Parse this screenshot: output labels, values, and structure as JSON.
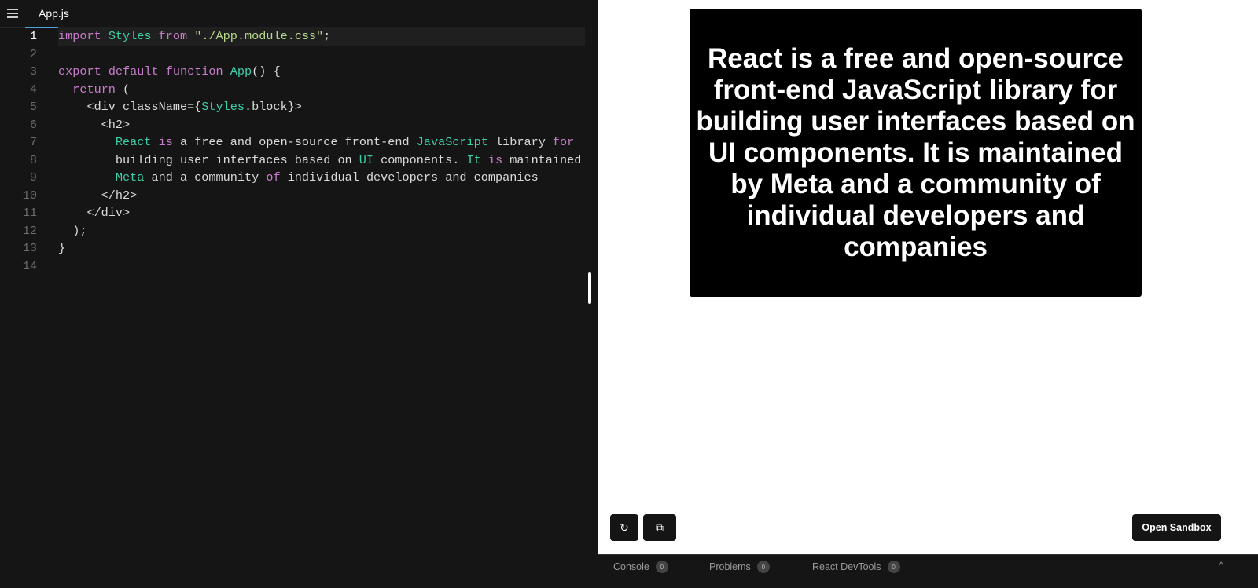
{
  "editor": {
    "tab": "App.js",
    "active_line": 1,
    "lines": [
      [
        [
          "kw",
          "import"
        ],
        [
          "p",
          " "
        ],
        [
          "id",
          "Styles"
        ],
        [
          "p",
          " "
        ],
        [
          "kw",
          "from"
        ],
        [
          "p",
          " "
        ],
        [
          "str",
          "\"./App.module.css\""
        ],
        [
          "p",
          ";"
        ]
      ],
      [],
      [
        [
          "kw",
          "export"
        ],
        [
          "p",
          " "
        ],
        [
          "kw",
          "default"
        ],
        [
          "p",
          " "
        ],
        [
          "kw",
          "function"
        ],
        [
          "p",
          " "
        ],
        [
          "id",
          "App"
        ],
        [
          "p",
          "() {"
        ]
      ],
      [
        [
          "p",
          "  "
        ],
        [
          "kw",
          "return"
        ],
        [
          "p",
          " ("
        ]
      ],
      [
        [
          "p",
          "    <div className={"
        ],
        [
          "id",
          "Styles"
        ],
        [
          "p",
          ".block}>"
        ]
      ],
      [
        [
          "p",
          "      <h2>"
        ]
      ],
      [
        [
          "p",
          "        "
        ],
        [
          "id",
          "React"
        ],
        [
          "p",
          " "
        ],
        [
          "kw",
          "is"
        ],
        [
          "p",
          " a free and open-source front-end "
        ],
        [
          "id",
          "JavaScript"
        ],
        [
          "p",
          " library "
        ],
        [
          "kw",
          "for"
        ]
      ],
      [
        [
          "p",
          "        building user interfaces based on "
        ],
        [
          "id",
          "UI"
        ],
        [
          "p",
          " components. "
        ],
        [
          "id",
          "It"
        ],
        [
          "p",
          " "
        ],
        [
          "kw",
          "is"
        ],
        [
          "p",
          " maintained by"
        ]
      ],
      [
        [
          "p",
          "        "
        ],
        [
          "id",
          "Meta"
        ],
        [
          "p",
          " and a community "
        ],
        [
          "kw",
          "of"
        ],
        [
          "p",
          " individual developers and companies"
        ]
      ],
      [
        [
          "p",
          "      </h2>"
        ]
      ],
      [
        [
          "p",
          "    </div>"
        ]
      ],
      [
        [
          "p",
          "  );"
        ]
      ],
      [
        [
          "p",
          "}"
        ]
      ],
      []
    ]
  },
  "preview": {
    "heading": "React is a free and open-source front-end JavaScript library for building user interfaces based on UI components. It is maintained by Meta and a community of individual developers and companies",
    "refresh_icon": "↻",
    "open_icon": "⧉",
    "open_sandbox": "Open Sandbox"
  },
  "bottom": {
    "tabs": [
      {
        "label": "Console",
        "count": "0"
      },
      {
        "label": "Problems",
        "count": "0"
      },
      {
        "label": "React DevTools",
        "count": "0"
      }
    ],
    "caret": "^"
  }
}
